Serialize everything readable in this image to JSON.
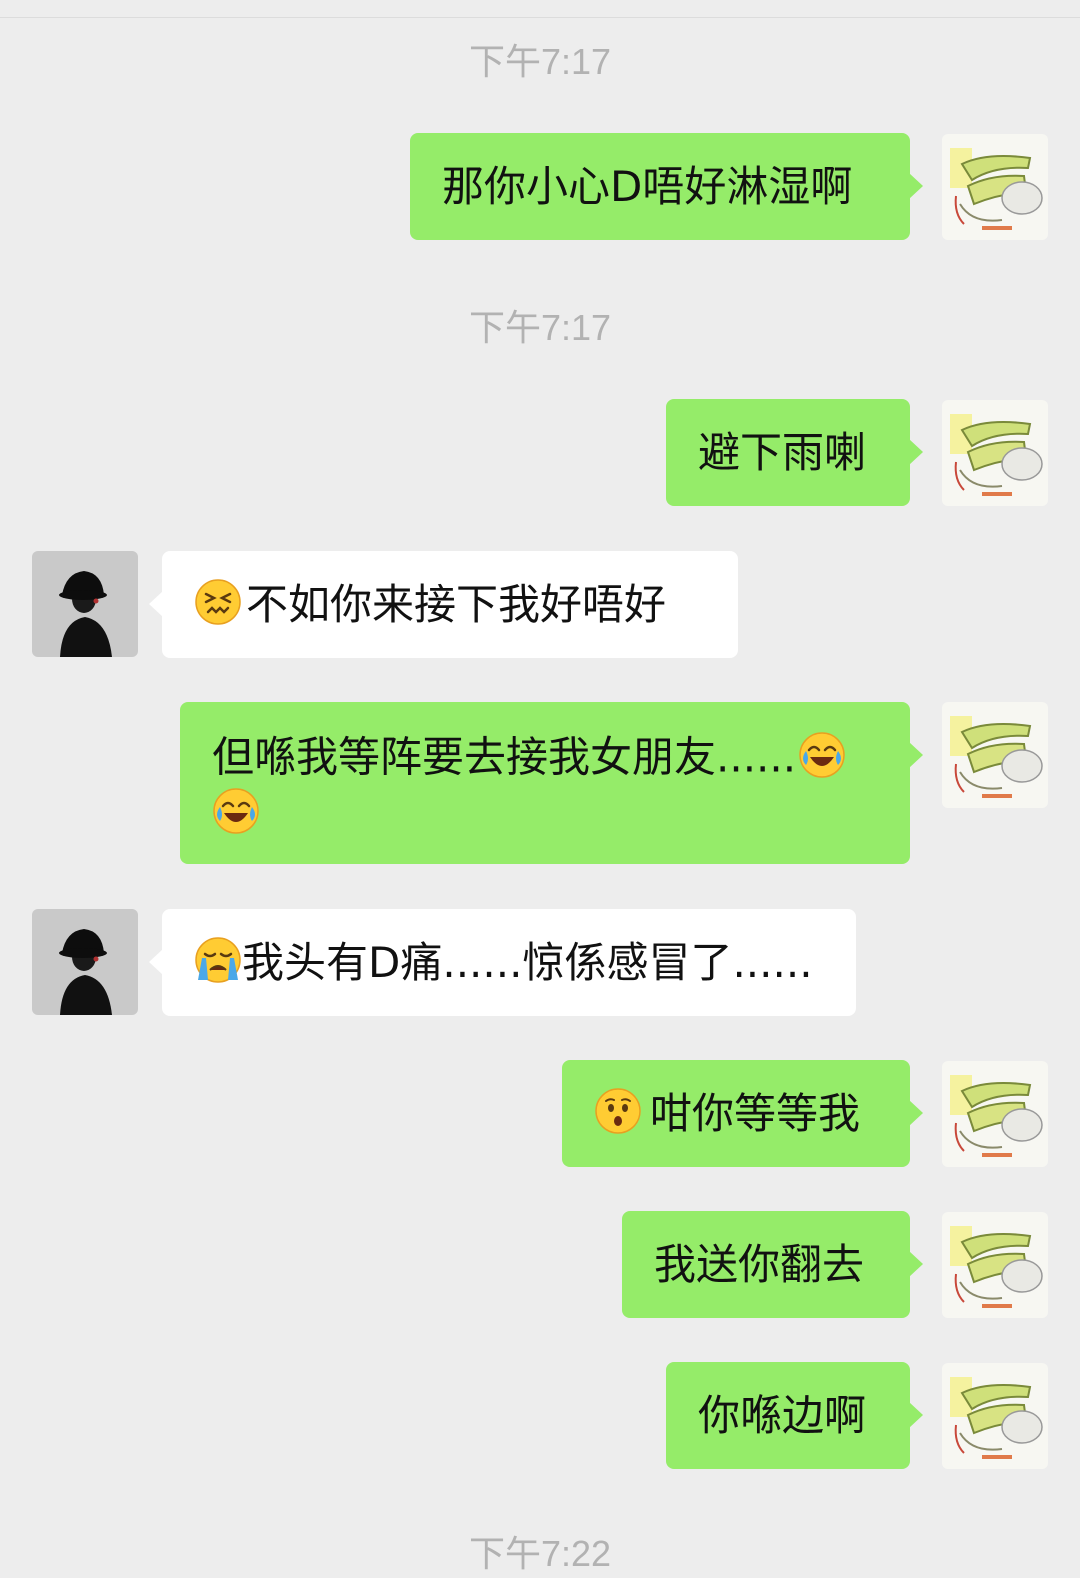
{
  "chat": {
    "timestamps": [
      "下午7:17",
      "下午7:17",
      "下午7:22"
    ],
    "messages": [
      {
        "id": "m1",
        "side": "out",
        "text": "那你小心D唔好淋湿啊"
      },
      {
        "id": "m2",
        "side": "out",
        "text": "避下雨喇"
      },
      {
        "id": "m3",
        "side": "in",
        "text": "不如你来接下我好唔好",
        "emoji": "confounded-face"
      },
      {
        "id": "m4",
        "side": "out",
        "text": "但喺我等阵要去接我女朋友......",
        "emoji_after": "face-with-tears-of-joy",
        "emoji_line2": "face-with-tears-of-joy"
      },
      {
        "id": "m5",
        "side": "in",
        "text": "我头有D痛......惊係感冒了......",
        "emoji": "loudly-crying-face"
      },
      {
        "id": "m6",
        "side": "out",
        "text": "咁你等等我",
        "emoji": "hushed-face"
      },
      {
        "id": "m7",
        "side": "out",
        "text": "我送你翻去"
      },
      {
        "id": "m8",
        "side": "out",
        "text": "你喺边啊"
      }
    ]
  },
  "colors": {
    "background": "#ededed",
    "outgoing_bubble": "#95ec69",
    "incoming_bubble": "#ffffff",
    "timestamp_text": "#b2b2b2"
  }
}
